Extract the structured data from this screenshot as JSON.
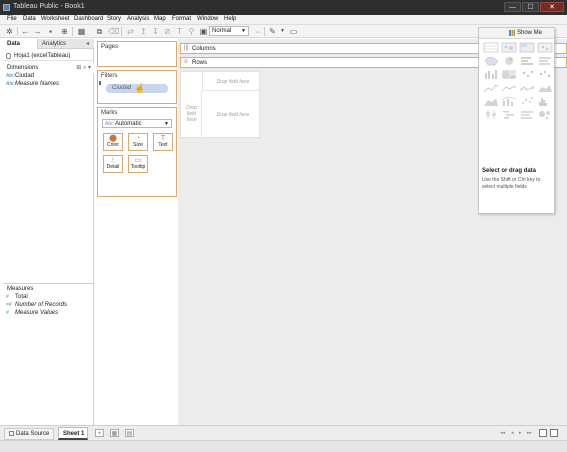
{
  "window": {
    "title": "Tableau Public - Book1",
    "controls": [
      "—",
      "☐",
      "✕"
    ]
  },
  "menu": [
    "File",
    "Data",
    "Worksheet",
    "Dashboard",
    "Story",
    "Analysis",
    "Map",
    "Format",
    "Window",
    "Help"
  ],
  "toolbar": {
    "fit_value": "Normal"
  },
  "left_pane": {
    "tabs": [
      "Data",
      "Analytics"
    ],
    "collapse": "◂",
    "datasource": "Hoja1 (excelTableau)",
    "dimensions_header": "Dimensions",
    "dimensions_header_icons": "⊞ ⌕ ▾",
    "dimensions": [
      {
        "icon": "Abc",
        "label": "Ciudad",
        "italic": false
      },
      {
        "icon": "Abc",
        "label": "Measure Names",
        "italic": true
      }
    ],
    "measures_header": "Measures",
    "measures": [
      {
        "icon": "#",
        "label": "Total",
        "italic": false
      },
      {
        "icon": "=#",
        "label": "Number of Records",
        "italic": true
      },
      {
        "icon": "#",
        "label": "Measure Values",
        "italic": true
      }
    ]
  },
  "cards": {
    "pages": "Pages",
    "filters": "Filters",
    "dragged_pill": "Ciudad",
    "marks": "Marks",
    "mark_type_prefix": "Abc",
    "mark_type": "Automatic",
    "mark_buttons": [
      {
        "icon": "⬤",
        "label": "Color"
      },
      {
        "icon": "◔",
        "label": "Size"
      },
      {
        "icon": "T",
        "label": "Text"
      },
      {
        "icon": "⁝",
        "label": "Detail"
      },
      {
        "icon": "▭",
        "label": "Tooltip"
      }
    ]
  },
  "shelves": {
    "columns": "Columns",
    "rows": "Rows",
    "columns_icon": "|||",
    "rows_icon": "≡"
  },
  "dropzone": {
    "top_right": "Drop field here",
    "left": "Drop field here",
    "center": "Drop field here"
  },
  "show_me": {
    "label": "Show Me",
    "title": "Select or drag data",
    "hint": "Use the Shift or Ctrl key to select multiple fields"
  },
  "bottom": {
    "datasource_tab": "Data Source",
    "sheet_tab": "Sheet 1"
  },
  "colors": {
    "accent_orange": "#e0a86a",
    "pill_blue": "#c8d6ea",
    "dimension_blue": "#4b7fb5",
    "measure_green": "#3a9a5e"
  }
}
